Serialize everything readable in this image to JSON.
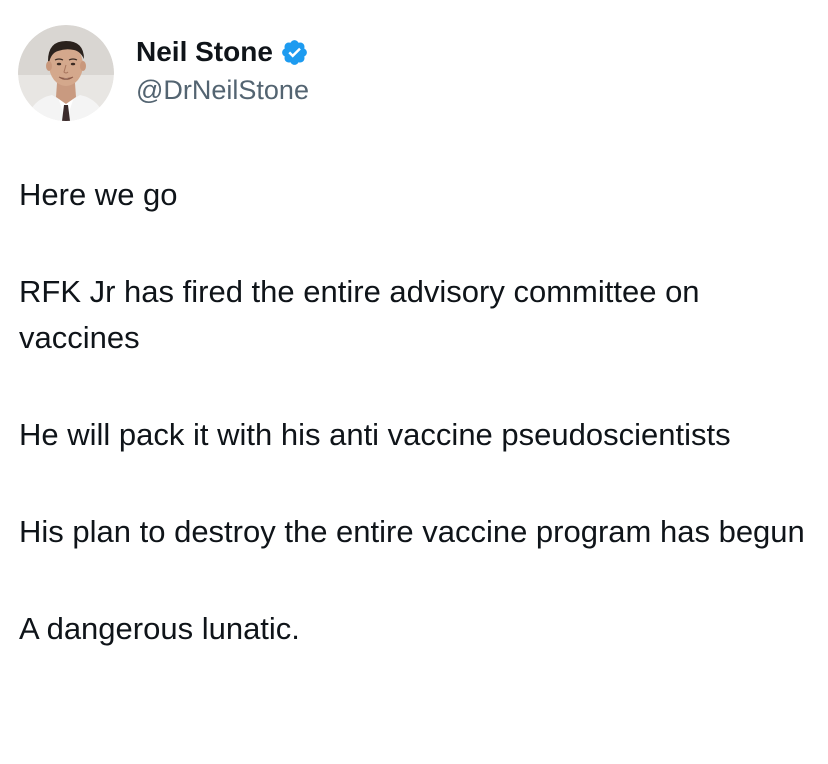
{
  "author": {
    "display_name": "Neil Stone",
    "handle": "@DrNeilStone",
    "verified": true,
    "avatar_icon": "profile-photo"
  },
  "colors": {
    "text": "#0f1419",
    "secondary_text": "#536471",
    "verified_badge": "#1d9bf0",
    "background": "#ffffff"
  },
  "tweet": {
    "paragraphs": [
      "Here we go",
      "RFK Jr has fired the entire advisory committee on vaccines",
      "He will pack it with his anti vaccine pseudoscientists",
      "His plan to destroy the entire vaccine program has begun",
      "A dangerous lunatic."
    ]
  }
}
